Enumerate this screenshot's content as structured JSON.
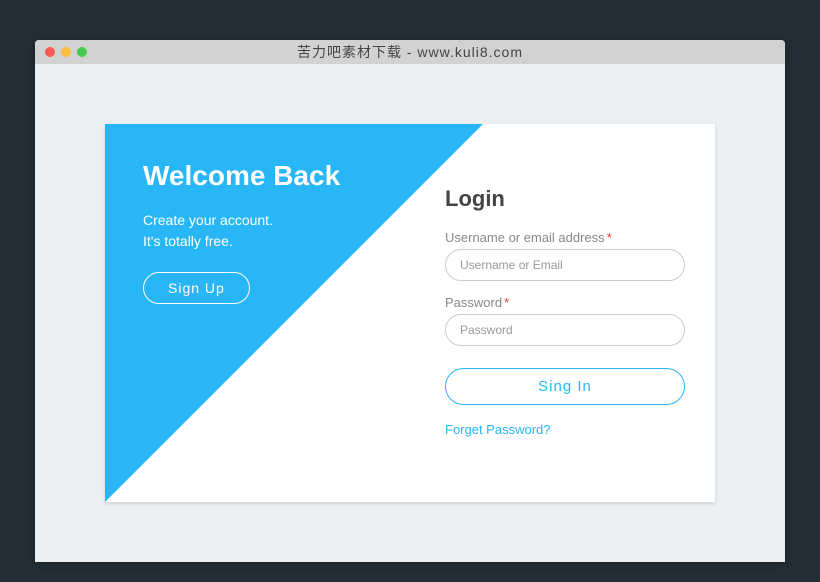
{
  "titlebar": {
    "text": "苦力吧素材下载 - www.kuli8.com"
  },
  "welcome": {
    "title": "Welcome Back",
    "line1": "Create your account.",
    "line2": "It's totally free.",
    "signup_label": "Sign Up"
  },
  "login": {
    "title": "Login",
    "username_label": "Username or email address",
    "username_placeholder": "Username or Email",
    "password_label": "Password",
    "password_placeholder": "Password",
    "signin_label": "Sing In",
    "forget_label": "Forget Password?"
  },
  "colors": {
    "accent": "#29b6f6",
    "background": "#232e36",
    "page": "#ecf0f3"
  }
}
